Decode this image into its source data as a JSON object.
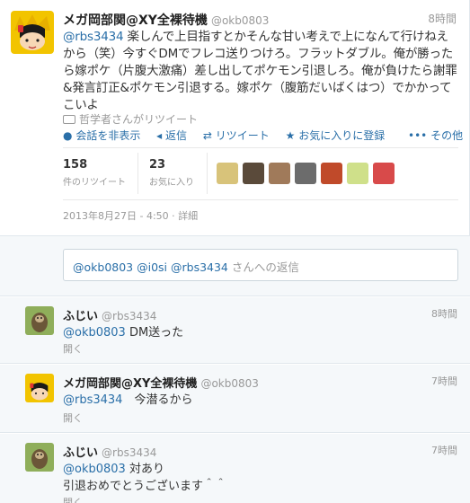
{
  "main_tweet": {
    "display_name": "メガ岡部関@XY全裸待機",
    "handle": "@okb0803",
    "time": "8時間",
    "mention": "@rbs3434",
    "text": " 楽しんで上目指すとかそんな甘い考えで上になんて行けねえから（笑）今すぐDMでフレコ送りつけろ。フラットダブル。俺が勝ったら嫁ポケ（片腹大激痛）差し出してポケモン引退しろ。俺が負けたら謝罪&発言訂正&ポケモン引退する。嫁ポケ（腹筋だいばくはつ）でかかってこいよ",
    "retweeted_by": "哲学者さんがリツイート",
    "actions": {
      "hide_conversation": "会話を非表示",
      "reply": "返信",
      "retweet": "リツイート",
      "favorite": "お気に入りに登録",
      "more": "その他"
    },
    "stats": {
      "retweets_count": "158",
      "retweets_label": "件のリツイート",
      "favorites_count": "23",
      "favorites_label": "お気に入り"
    },
    "date": "2013年8月27日 - 4:50",
    "details": "詳細"
  },
  "reply_box": {
    "mentions": "@okb0803 @i0si @rbs3434",
    "suffix": " さんへの返信"
  },
  "replies": [
    {
      "display_name": "ふじい",
      "handle": "@rbs3434",
      "time": "8時間",
      "mention": "@okb0803",
      "text": " DM送った",
      "line2": "",
      "open": "開く"
    },
    {
      "display_name": "メガ岡部関@XY全裸待機",
      "handle": "@okb0803",
      "time": "7時間",
      "mention": "@rbs3434",
      "text": "　今潜るから",
      "line2": "",
      "open": "開く"
    },
    {
      "display_name": "ふじい",
      "handle": "@rbs3434",
      "time": "7時間",
      "mention": "@okb0803",
      "text": " 対あり",
      "line2": "引退おめでとうございます＾＾",
      "open": "開く"
    }
  ],
  "icons": {
    "hide": "speech-bubble-icon",
    "reply": "reply-arrow-icon",
    "retweet": "retweet-icon",
    "favorite": "star-icon",
    "more": "ellipsis-icon"
  }
}
